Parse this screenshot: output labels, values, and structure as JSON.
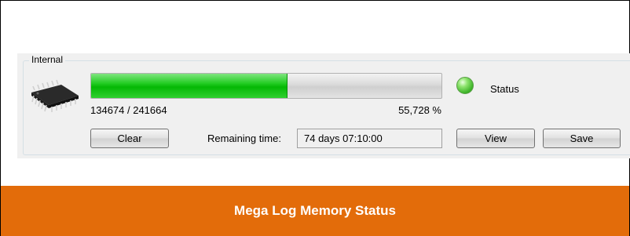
{
  "group": {
    "legend": "Internal"
  },
  "memory": {
    "icon": "memory-chip-icon",
    "used": 134674,
    "total": 241664,
    "count_text": "134674 / 241664",
    "percent_text": "55,728 %",
    "progress_fraction": 0.55728
  },
  "status": {
    "label": "Status",
    "indicator_color": "#3fb52a",
    "icon": "status-led-icon"
  },
  "buttons": {
    "clear": "Clear",
    "view": "View",
    "save": "Save"
  },
  "remaining": {
    "label": "Remaining time:",
    "value": "74 days 07:10:00"
  },
  "footer": {
    "title": "Mega Log Memory Status",
    "color": "#e36c0a"
  }
}
